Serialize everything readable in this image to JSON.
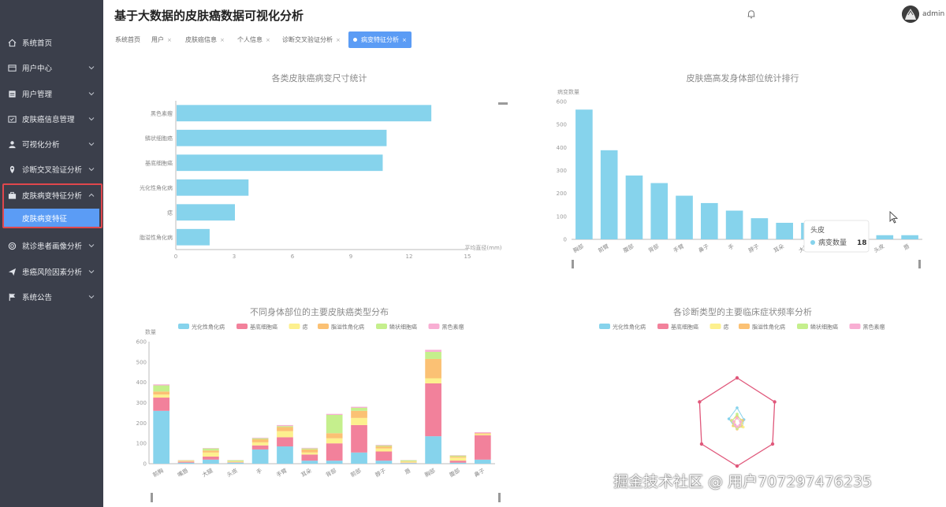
{
  "app_title": "基于大数据的皮肤癌数据可视化分析",
  "user": {
    "name": "admin"
  },
  "sidebar": {
    "items": [
      {
        "label": "系统首页",
        "icon": "home-icon",
        "has_children": false
      },
      {
        "label": "用户中心",
        "icon": "user-card-icon",
        "has_children": true
      },
      {
        "label": "用户管理",
        "icon": "table-icon",
        "has_children": true
      },
      {
        "label": "皮肤癌信息管理",
        "icon": "checkbox-icon",
        "has_children": true
      },
      {
        "label": "可视化分析",
        "icon": "person-icon",
        "has_children": true
      },
      {
        "label": "诊断交叉验证分析",
        "icon": "location-icon",
        "has_children": true
      },
      {
        "label": "皮肤病变特征分析",
        "icon": "briefcase-icon",
        "has_children": true,
        "expanded": true
      },
      {
        "label": "就诊患者画像分析",
        "icon": "circle-icon",
        "has_children": true
      },
      {
        "label": "患癌风险因素分析",
        "icon": "send-icon",
        "has_children": true
      },
      {
        "label": "系统公告",
        "icon": "flag-icon",
        "has_children": true
      }
    ],
    "active_sub": "皮肤病变特征"
  },
  "tabs": [
    {
      "label": "系统首页",
      "closable": false
    },
    {
      "label": "用户",
      "closable": true
    },
    {
      "label": "皮肤癌信息",
      "closable": true
    },
    {
      "label": "个人信息",
      "closable": true
    },
    {
      "label": "诊断交叉验证分析",
      "closable": true
    },
    {
      "label": "病变特征分析",
      "closable": true,
      "active": true
    }
  ],
  "colors": {
    "sidebar_bg": "#3b3f4b",
    "accent": "#5b9cf5",
    "bar_blue": "#86d3ec",
    "highlight_border": "#e0474c",
    "series": [
      "#86d3ec",
      "#f2819b",
      "#fdf08e",
      "#fbc174",
      "#c5ef8d",
      "#f8aed3"
    ]
  },
  "watermark": "掘金技术社区 @ 用户707297476235",
  "chart_data": [
    {
      "type": "bar",
      "orientation": "horizontal",
      "title": "各类皮肤癌病变尺寸统计",
      "categories": [
        "黑色素瘤",
        "鳞状细胞癌",
        "基底细胞癌",
        "光化性角化病",
        "痣",
        "脂溢性角化病"
      ],
      "values": [
        13.1,
        10.8,
        10.6,
        3.7,
        3.0,
        1.7
      ],
      "xlim": [
        0,
        15
      ],
      "xticks": [
        "0",
        "3",
        "6",
        "9",
        "12",
        "15"
      ],
      "xlabel": "平均直径(mm)"
    },
    {
      "type": "bar",
      "title": "皮肤癌高发身体部位统计排行",
      "ylabel": "病变数量",
      "categories": [
        "胸部",
        "前臂",
        "腹部",
        "背部",
        "手臂",
        "鼻子",
        "手",
        "脖子",
        "耳朵",
        "大腿",
        "",
        "",
        "头皮",
        "唇"
      ],
      "values": [
        565,
        388,
        278,
        245,
        190,
        158,
        125,
        92,
        72,
        72,
        0,
        0,
        18,
        18
      ],
      "ylim": [
        0,
        600
      ],
      "yticks": [
        "0",
        "100",
        "200",
        "300",
        "400",
        "500",
        "600"
      ],
      "tooltip": {
        "category": "头皮",
        "series": "病变数量",
        "value": "18"
      }
    },
    {
      "type": "bar",
      "stacked": true,
      "title": "不同身体部位的主要皮肤癌类型分布",
      "ylabel": "数量",
      "categories": [
        "前胸",
        "嘴唇",
        "大腿",
        "头皮",
        "手",
        "手臂",
        "耳朵",
        "背部",
        "前部",
        "脖子",
        "唇",
        "胸部",
        "腹部",
        "鼻子"
      ],
      "ylim": [
        0,
        600
      ],
      "yticks": [
        "0",
        "100",
        "200",
        "300",
        "400",
        "500",
        "600"
      ],
      "series": [
        {
          "name": "光化性角化病",
          "values": [
            260,
            5,
            20,
            5,
            70,
            85,
            15,
            15,
            55,
            15,
            3,
            135,
            5,
            20
          ]
        },
        {
          "name": "基底细胞癌",
          "values": [
            65,
            5,
            15,
            2,
            20,
            45,
            30,
            85,
            135,
            45,
            2,
            260,
            10,
            120
          ]
        },
        {
          "name": "痣",
          "values": [
            15,
            3,
            20,
            3,
            15,
            30,
            10,
            25,
            35,
            15,
            5,
            25,
            15,
            5
          ]
        },
        {
          "name": "脂溢性角化病",
          "values": [
            15,
            2,
            10,
            2,
            15,
            20,
            15,
            25,
            35,
            10,
            2,
            95,
            5,
            5
          ]
        },
        {
          "name": "鳞状细胞癌",
          "values": [
            30,
            2,
            10,
            5,
            5,
            5,
            5,
            90,
            15,
            5,
            5,
            35,
            5,
            0
          ]
        },
        {
          "name": "黑色素瘤",
          "values": [
            5,
            1,
            2,
            1,
            3,
            5,
            3,
            5,
            5,
            3,
            1,
            10,
            2,
            5
          ]
        }
      ]
    },
    {
      "type": "radar",
      "title": "各诊断类型的主要临床症状频率分析",
      "legend": [
        "光化性角化病",
        "基底细胞癌",
        "痣",
        "脂溢性角化病",
        "鳞状细胞癌",
        "黑色素瘤"
      ],
      "axes_count": 6,
      "series": [
        {
          "name": "光化性角化病",
          "values": [
            0.2,
            0.1,
            0.08,
            0.06,
            0.05,
            0.12
          ]
        },
        {
          "name": "基底细胞癌",
          "values": [
            0.58,
            0.55,
            0.52,
            0.54,
            0.52,
            0.55
          ]
        },
        {
          "name": "痣",
          "values": [
            0.1,
            0.07,
            0.09,
            0.05,
            0.06,
            0.04
          ]
        },
        {
          "name": "脂溢性角化病",
          "values": [
            0.09,
            0.08,
            0.06,
            0.07,
            0.05,
            0.08
          ]
        },
        {
          "name": "鳞状细胞癌",
          "values": [
            0.12,
            0.06,
            0.05,
            0.06,
            0.04,
            0.07
          ]
        },
        {
          "name": "黑色素瘤",
          "values": [
            0.07,
            0.05,
            0.04,
            0.04,
            0.03,
            0.05
          ]
        }
      ]
    }
  ]
}
